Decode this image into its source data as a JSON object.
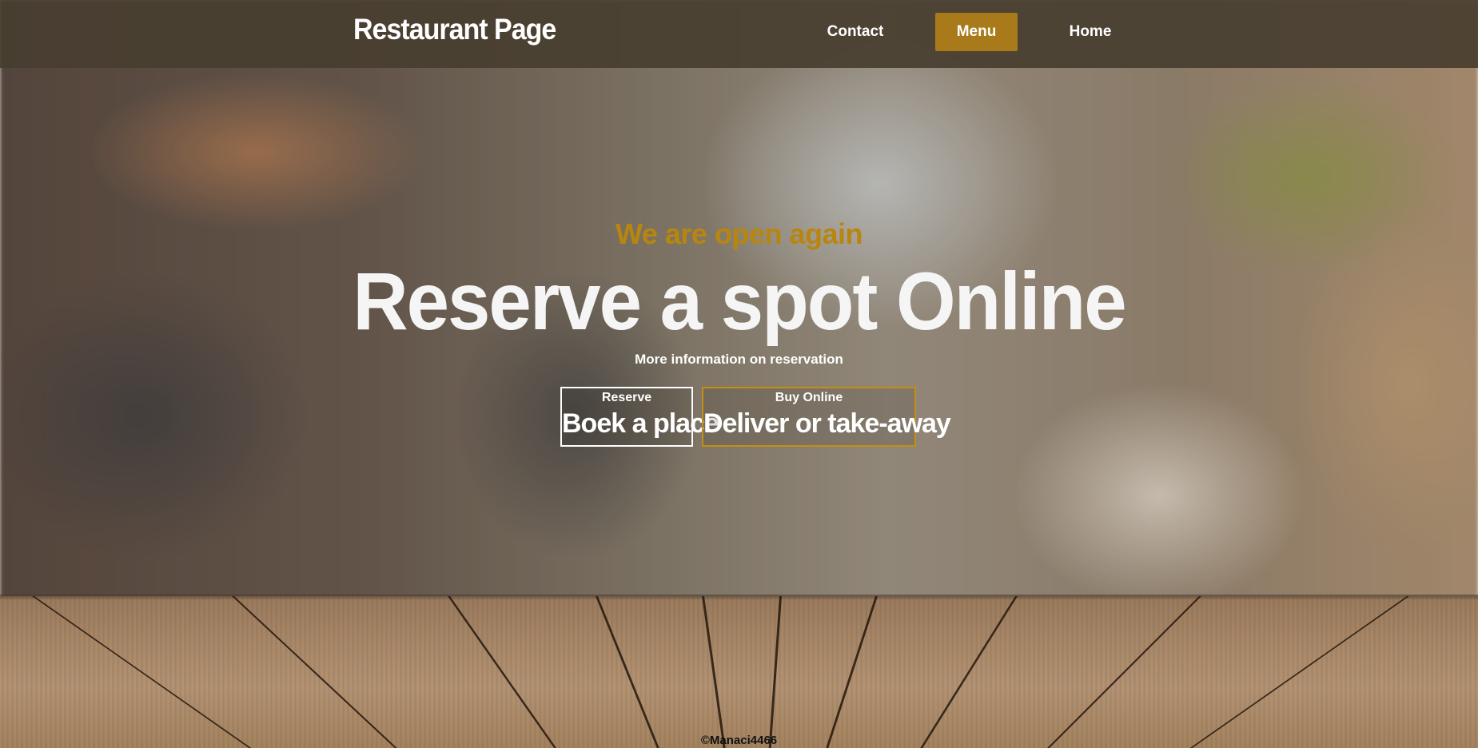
{
  "header": {
    "brand": "Restaurant Page",
    "nav": [
      {
        "label": "Contact",
        "active": false
      },
      {
        "label": "Menu",
        "active": true
      },
      {
        "label": "Home",
        "active": false
      }
    ]
  },
  "hero": {
    "eyebrow": "We are open again",
    "title": "Reserve a spot Online",
    "subtitle": "More information on reservation",
    "actions": [
      {
        "small_label": "Reserve",
        "big_label": "Boek a place"
      },
      {
        "small_label": "Buy Online",
        "big_label": "Deliver or take-away"
      }
    ]
  },
  "footer": {
    "credit": "©Manaci4466"
  },
  "colors": {
    "accent": "#a97a1a",
    "eyebrow": "#b8860f",
    "header_bg": "#483e30"
  }
}
